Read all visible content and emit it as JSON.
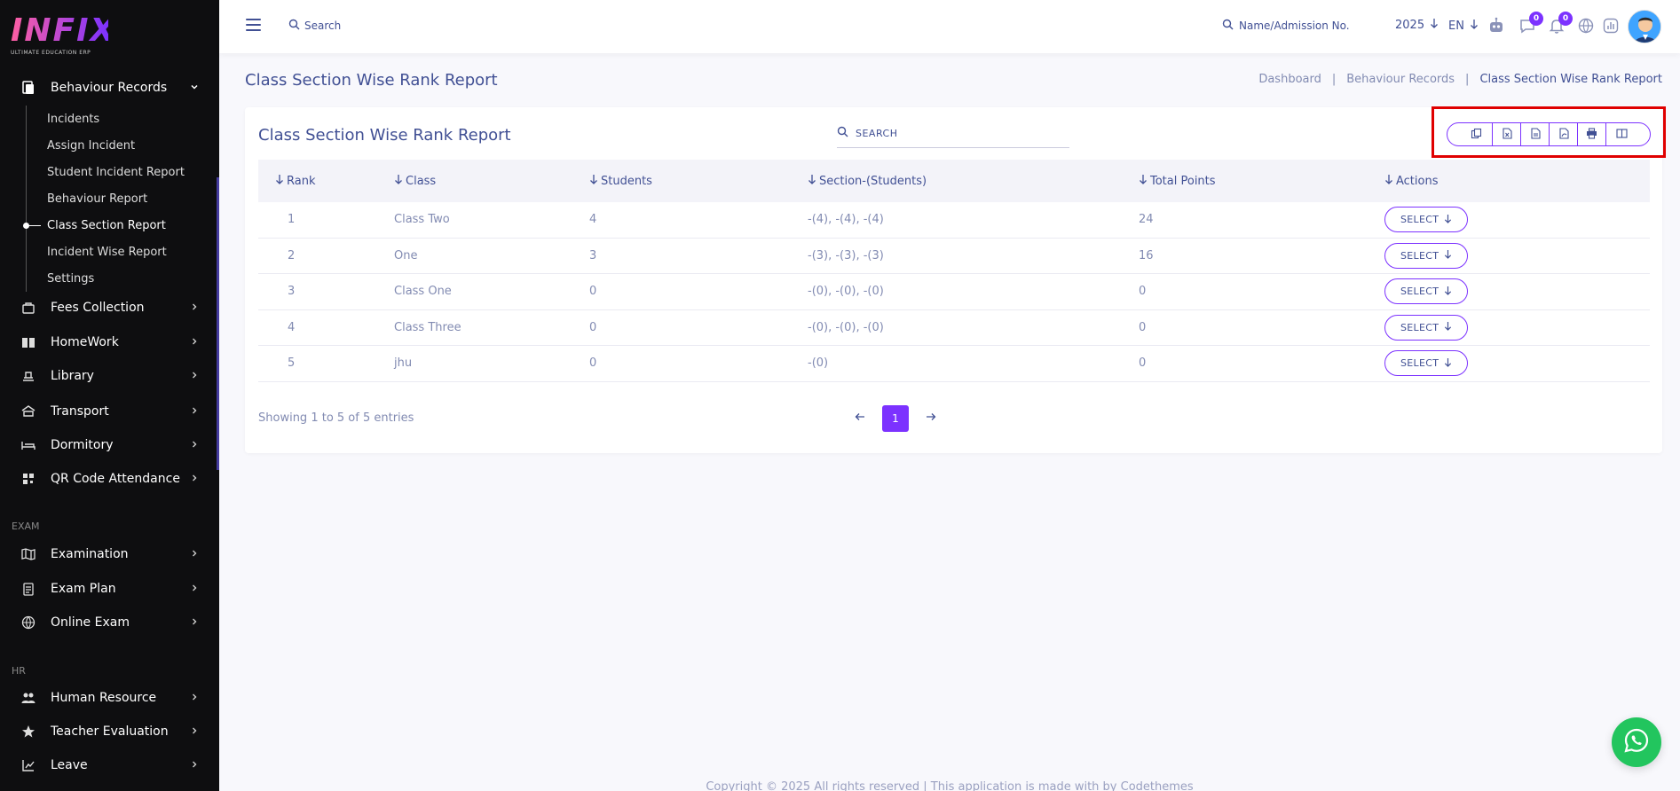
{
  "brand": {
    "logo_text": "INFIX",
    "logo_sub": "ULTIMATE EDUCATION ERP"
  },
  "sidebar": {
    "open_menu": "Behaviour Records",
    "submenu": [
      "Incidents",
      "Assign Incident",
      "Student Incident Report",
      "Behaviour Report",
      "Class Section Report",
      "Incident Wise Report",
      "Settings"
    ],
    "active_submenu": "Class Section Report",
    "items": [
      {
        "label": "Fees Collection",
        "icon": "fees-icon"
      },
      {
        "label": "HomeWork",
        "icon": "book-icon"
      },
      {
        "label": "Library",
        "icon": "library-icon"
      },
      {
        "label": "Transport",
        "icon": "bus-icon"
      },
      {
        "label": "Dormitory",
        "icon": "bed-icon"
      },
      {
        "label": "QR Code Attendance",
        "icon": "qr-icon"
      }
    ],
    "exam_label": "EXAM",
    "exam_items": [
      {
        "label": "Examination",
        "icon": "map-icon"
      },
      {
        "label": "Exam Plan",
        "icon": "clipboard-icon"
      },
      {
        "label": "Online Exam",
        "icon": "globe-icon"
      }
    ],
    "hr_label": "HR",
    "hr_items": [
      {
        "label": "Human Resource",
        "icon": "users-icon"
      },
      {
        "label": "Teacher Evaluation",
        "icon": "star-icon"
      },
      {
        "label": "Leave",
        "icon": "leave-icon"
      }
    ]
  },
  "topbar": {
    "search_label": "Search",
    "admission_search": "Name/Admission No.",
    "year": "2025",
    "language": "EN",
    "chat_badge": "0",
    "notification_badge": "0"
  },
  "page": {
    "title": "Class Section Wise Rank Report",
    "breadcrumb": [
      "Dashboard",
      "Behaviour Records",
      "Class Section Wise Rank Report"
    ]
  },
  "card": {
    "title": "Class Section Wise Rank Report",
    "search_placeholder": "SEARCH",
    "export_buttons": [
      "copy-icon",
      "excel-icon",
      "csv-icon",
      "pdf-icon",
      "print-icon",
      "columns-icon"
    ]
  },
  "table": {
    "headers": [
      "Rank",
      "Class",
      "Students",
      "Section-(Students)",
      "Total Points",
      "Actions"
    ],
    "rows": [
      {
        "rank": "1",
        "class": "Class Two",
        "students": "4",
        "section": "-(4), -(4), -(4)",
        "points": "24",
        "action": "SELECT"
      },
      {
        "rank": "2",
        "class": "One",
        "students": "3",
        "section": "-(3), -(3), -(3)",
        "points": "16",
        "action": "SELECT"
      },
      {
        "rank": "3",
        "class": "Class One",
        "students": "0",
        "section": "-(0), -(0), -(0)",
        "points": "0",
        "action": "SELECT"
      },
      {
        "rank": "4",
        "class": "Class Three",
        "students": "0",
        "section": "-(0), -(0), -(0)",
        "points": "0",
        "action": "SELECT"
      },
      {
        "rank": "5",
        "class": "jhu",
        "students": "0",
        "section": "-(0)",
        "points": "0",
        "action": "SELECT"
      }
    ],
    "entries_info": "Showing 1 to 5 of 5 entries",
    "current_page": "1"
  },
  "footer": {
    "text": "Copyright © 2025 All rights reserved | This application is made with by Codethemes"
  },
  "colors": {
    "accent": "#7c32ff",
    "text": "#415094",
    "muted": "#828bb2",
    "sidebar_bg": "#0e0e10",
    "highlight": "#e00000"
  }
}
